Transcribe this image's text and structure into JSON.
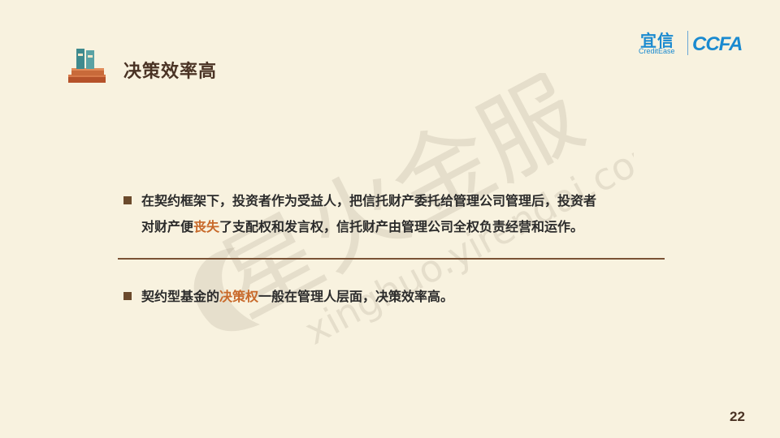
{
  "title": "决策效率高",
  "logos": {
    "yixin_cn": "宜信",
    "yixin_en": "CreditEase",
    "ccfa": "CCFA"
  },
  "watermark": {
    "text": "星火金服",
    "url": "xinghuo.yirendai.com"
  },
  "bullet1": {
    "line1": "在契约框架下，投资者作为受益人，把信托财产委托给管理公司管理后，投资者",
    "line2_pre": "对财产便",
    "line2_highlight": "丧失",
    "line2_post": "了支配权和发言权，信托财产由管理公司全权负责经营和运作。"
  },
  "bullet2": {
    "pre": "契约型基金的",
    "highlight": "决策权",
    "post": "一般在管理人层面，决策效率高。"
  },
  "page_number": "22",
  "colors": {
    "background": "#f8f2df",
    "highlight": "#c8692a",
    "title": "#4a3324",
    "logo_blue": "#1a8ad0"
  }
}
